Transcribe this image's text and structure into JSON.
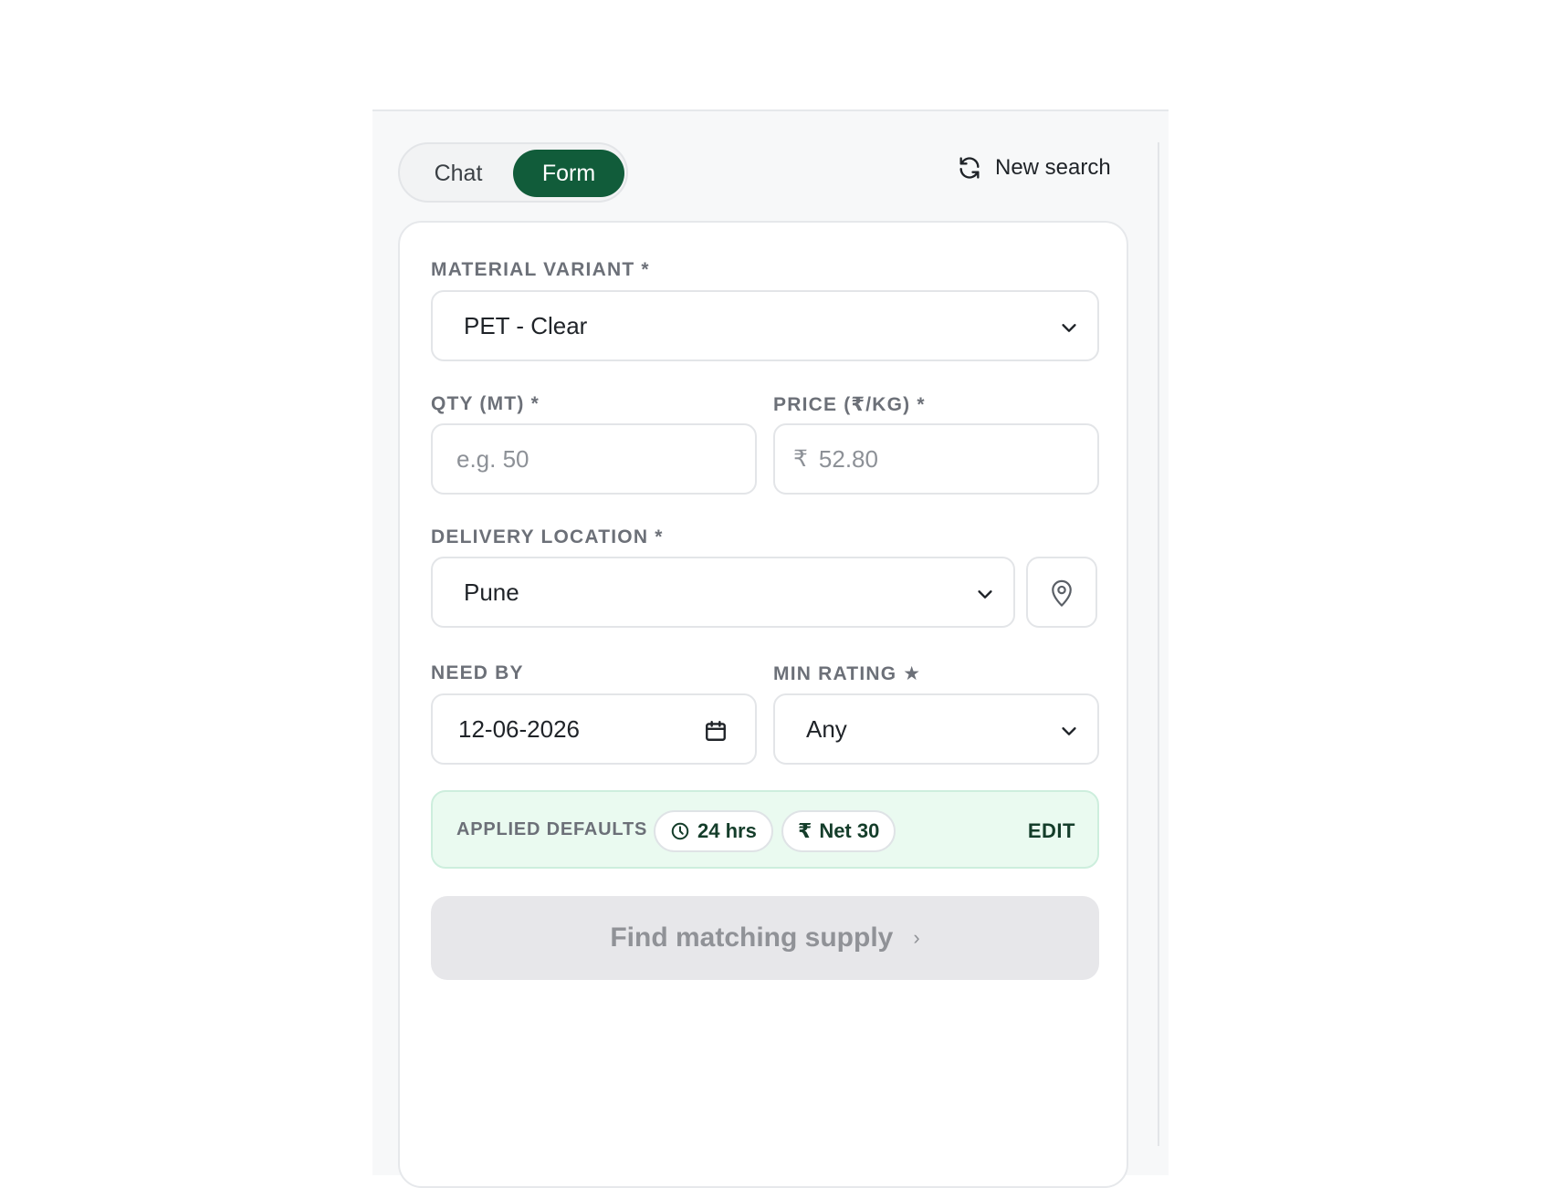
{
  "mode_toggle": {
    "chat_label": "Chat",
    "form_label": "Form",
    "active": "Form"
  },
  "header": {
    "new_search_label": "New search"
  },
  "form": {
    "material_variant": {
      "label": "MATERIAL VARIANT *",
      "value": "PET - Clear"
    },
    "qty": {
      "label": "QTY (MT) *",
      "placeholder": "e.g. 50"
    },
    "price": {
      "label": "PRICE (₹/KG) *",
      "currency_symbol": "₹",
      "placeholder": "52.80"
    },
    "delivery_location": {
      "label": "DELIVERY LOCATION *",
      "value": "Pune"
    },
    "need_by": {
      "label": "NEED BY",
      "value": "12-06-2026"
    },
    "min_rating": {
      "label": "MIN RATING ★",
      "value": "Any"
    }
  },
  "applied_defaults": {
    "label": "APPLIED DEFAULTS",
    "pills": [
      {
        "icon": "clock-icon",
        "text": "24 hrs"
      },
      {
        "icon": "rupee-icon",
        "text": "Net 30"
      }
    ],
    "edit_label": "EDIT"
  },
  "submit": {
    "label": "Find matching supply",
    "arrow": "›"
  },
  "colors": {
    "brand_green": "#115c3a",
    "defaults_bg": "#eafaf0",
    "disabled_button_bg": "#e7e7ea",
    "disabled_button_text": "#909297"
  }
}
